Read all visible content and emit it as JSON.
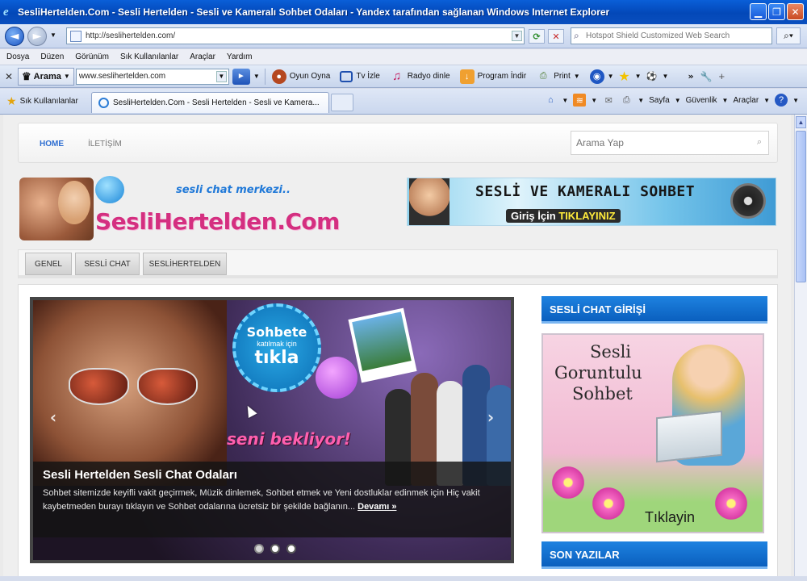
{
  "window": {
    "title": "SesliHertelden.Com - Sesli Hertelden - Sesli ve Kameralı Sohbet Odaları - Yandex tarafından sağlanan Windows Internet Explorer"
  },
  "address": {
    "url": "http://seslihertelden.com/",
    "search_placeholder": "Hotspot Shield Customized Web Search"
  },
  "menu": [
    "Dosya",
    "Düzen",
    "Görünüm",
    "Sık Kullanılanlar",
    "Araçlar",
    "Yardım"
  ],
  "yandex": {
    "search_label": "Arama",
    "search_value": "www.seslihertelden.com",
    "items": [
      "Oyun Oyna",
      "Tv İzle",
      "Radyo dinle",
      "Program İndir",
      "Print"
    ]
  },
  "favorites": {
    "label": "Sık Kullanılanlar",
    "tab_title": "SesliHertelden.Com - Sesli Hertelden - Sesli ve Kamera...",
    "commands": [
      "Sayfa",
      "Güvenlik",
      "Araçlar"
    ]
  },
  "site": {
    "nav": [
      "HOME",
      "İLETİŞİM"
    ],
    "search_placeholder": "Arama Yap",
    "logo_tagline": "sesli chat merkezi..",
    "logo_brand": "SesliHertelden.Com",
    "banner_line1": "SESLİ VE KAMERALI SOHBET",
    "banner_line2_pre": "Giriş İçin ",
    "banner_line2_em": "TIKLAYINIZ",
    "categories": [
      "GENEL",
      "SESLİ CHAT",
      "SESLİHERTELDEN"
    ],
    "slider": {
      "burst_top": "Sohbete",
      "burst_mid": "katılmak için",
      "burst_big": "tıkla",
      "overlay_text": "seni bekliyor!",
      "caption_title": "Sesli Hertelden Sesli Chat Odaları",
      "caption_text": "Sohbet sitemizde keyifli vakit geçirmek, Müzik dinlemek, Sohbet etmek ve Yeni dostluklar edinmek için Hiç vakit kaybetmeden burayı tıklayın ve Sohbet odalarına ücretsiz bir şekilde bağlanın...",
      "caption_more": "Devamı »",
      "prev": "‹",
      "next": "›"
    },
    "sidebar": {
      "widget1_title": "SESLİ CHAT GİRİŞİ",
      "ad_text_line1": "Sesli",
      "ad_text_line2": "Goruntulu",
      "ad_text_line3": "Sohbet",
      "ad_click": "Tıklayin",
      "widget2_title": "SON YAZILAR"
    }
  },
  "colors": {
    "accent_blue": "#0a5fbe",
    "brand_pink": "#d42f80",
    "titlebar": "#0348b8"
  }
}
